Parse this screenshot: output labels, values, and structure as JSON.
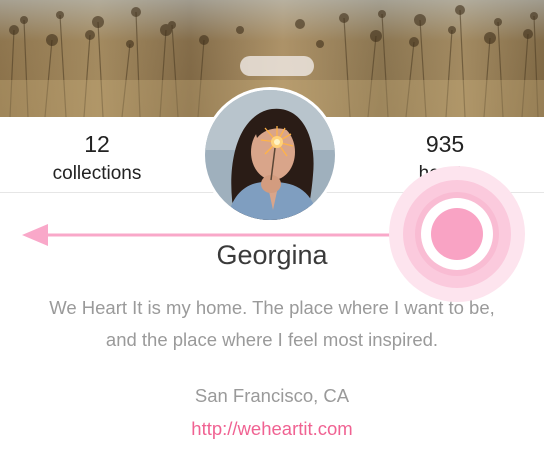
{
  "profile": {
    "name": "Georgina",
    "bio_line1": "We Heart It is my home. The place where I want to be,",
    "bio_line2": "and the place where I feel most inspired.",
    "location": "San Francisco, CA",
    "website": "http://weheartit.com"
  },
  "stats": {
    "collections_count": "12",
    "collections_label": "collections",
    "hearts_count": "935",
    "hearts_label": "hearts"
  },
  "gesture_hint": {
    "direction": "left",
    "color": "#f9a8c9"
  },
  "colors": {
    "accent": "#f06292",
    "text_primary": "#3a3a3a",
    "text_muted": "#9a9a9a"
  }
}
